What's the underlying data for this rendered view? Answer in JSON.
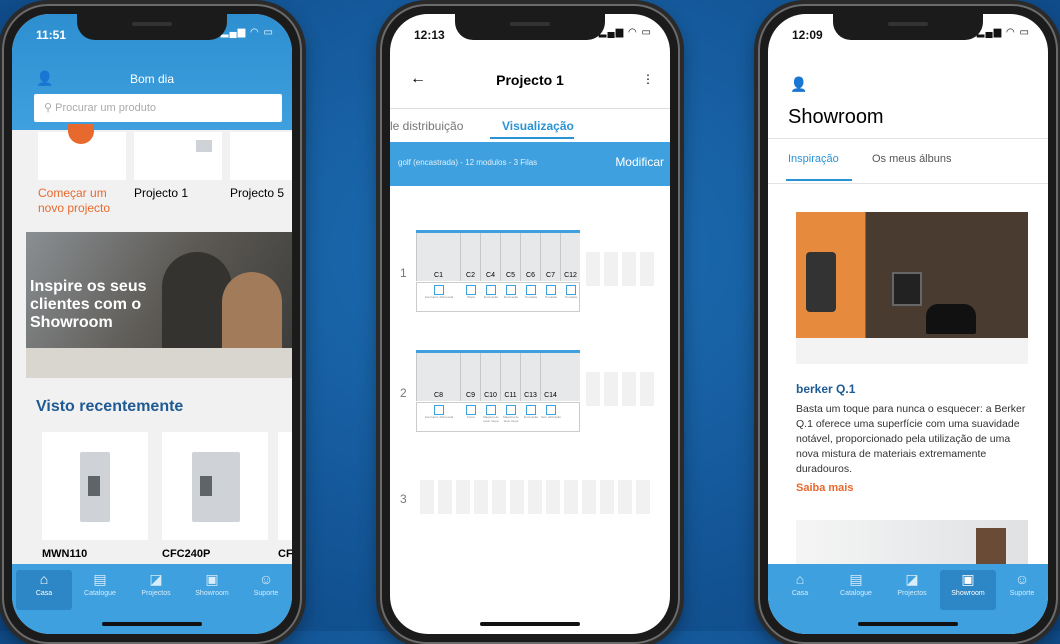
{
  "colors": {
    "brand": "#2a93d5",
    "accent": "#e8692e",
    "heading": "#1e5a93"
  },
  "phone1": {
    "time": "11:51",
    "greeting": "Bom dia",
    "search_placeholder": "Procurar um produto",
    "cards": [
      {
        "label": "Começar um novo projecto"
      },
      {
        "label": "Projecto 1"
      },
      {
        "label": "Projecto 5"
      }
    ],
    "hero_text": "Inspire os seus clientes com o Showroom",
    "recent_title": "Visto recentemente",
    "products": [
      "MWN110",
      "CFC240P",
      "CFC"
    ],
    "tabs": [
      "Casa",
      "Catalogue",
      "Projectos",
      "Showroom",
      "Suporte"
    ],
    "active_tab": "Casa"
  },
  "phone2": {
    "time": "12:13",
    "title": "Projecto 1",
    "tabs": [
      "le distribuição",
      "Visualização"
    ],
    "config": "golf (encastrada) - 12 modulos - 3 Filas",
    "modify": "Modificar",
    "rows": [
      {
        "num": "1",
        "labels": [
          "C1",
          "C2",
          "C4",
          "C5",
          "C6",
          "C7",
          "C12"
        ],
        "devices": [
          "Interruptor diferencial",
          "Placa",
          "Iluminação",
          "Iluminação",
          "Tomadas",
          "Tomadas",
          "Tomadas"
        ]
      },
      {
        "num": "2",
        "labels": [
          "C8",
          "C9",
          "C10",
          "C11",
          "C13",
          "C14"
        ],
        "devices": [
          "Interruptor diferencial",
          "Forno",
          "Máquina de lavar roupa",
          "Máquina de lavar louça",
          "Iluminação",
          "Sem atribuição"
        ]
      },
      {
        "num": "3",
        "labels": [],
        "devices": []
      }
    ]
  },
  "phone3": {
    "time": "12:09",
    "title": "Showroom",
    "tabs": [
      "Inspiração",
      "Os meus álbuns"
    ],
    "post_title": "berker Q.1",
    "post_text": "Basta um toque para nunca o esquecer: a Berker Q.1 oferece uma superfície com uma suavidade notável, proporcionado pela utilização de uma nova mistura de materiais extremamente duradouros.",
    "read_more": "Saiba mais",
    "bottom_tabs": [
      "Casa",
      "Catalogue",
      "Projectos",
      "Showroom",
      "Suporte"
    ],
    "active_tab": "Showroom"
  }
}
